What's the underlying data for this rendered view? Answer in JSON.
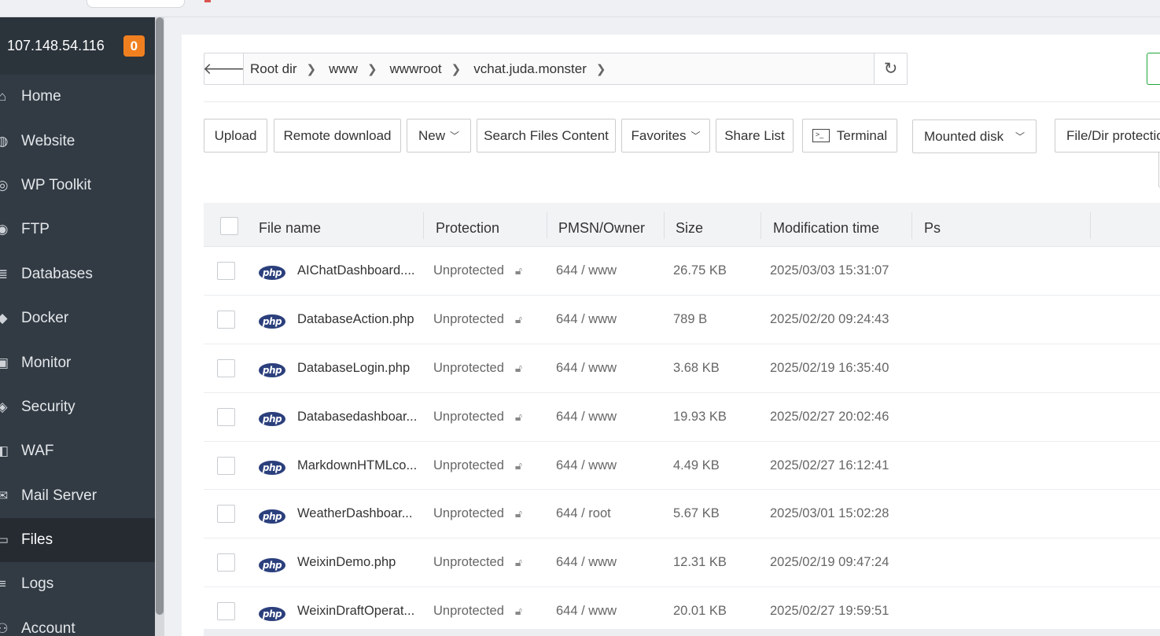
{
  "server": {
    "ip": "107.148.54.116",
    "badge": "0"
  },
  "sidebar": {
    "items": [
      {
        "label": "Home",
        "icon": "home-icon",
        "glyph": "⌂"
      },
      {
        "label": "Website",
        "icon": "globe-icon",
        "glyph": "◍"
      },
      {
        "label": "WP Toolkit",
        "icon": "wordpress-icon",
        "glyph": "◎"
      },
      {
        "label": "FTP",
        "icon": "ftp-icon",
        "glyph": "◉"
      },
      {
        "label": "Databases",
        "icon": "database-icon",
        "glyph": "≣"
      },
      {
        "label": "Docker",
        "icon": "docker-icon",
        "glyph": "◆"
      },
      {
        "label": "Monitor",
        "icon": "monitor-icon",
        "glyph": "▣"
      },
      {
        "label": "Security",
        "icon": "shield-icon",
        "glyph": "◈"
      },
      {
        "label": "WAF",
        "icon": "waf-icon",
        "glyph": "◧"
      },
      {
        "label": "Mail Server",
        "icon": "mail-icon",
        "glyph": "✉"
      },
      {
        "label": "Files",
        "icon": "folder-icon",
        "glyph": "▭",
        "active": true
      },
      {
        "label": "Logs",
        "icon": "logs-icon",
        "glyph": "≡"
      },
      {
        "label": "Account",
        "icon": "account-icon",
        "glyph": "⚇"
      }
    ]
  },
  "path": {
    "back_icon": "arrow-left-icon",
    "crumbs": [
      "Root dir",
      "www",
      "wwwroot",
      "vchat.juda.monster"
    ],
    "refresh_icon": "refresh-icon"
  },
  "toolbar": {
    "upload": "Upload",
    "remote_download": "Remote download",
    "new": "New",
    "search_content": "Search Files Content",
    "favorites": "Favorites",
    "share_list": "Share List",
    "terminal": "Terminal",
    "mounted_disk": "Mounted disk",
    "protection": "File/Dir protectio"
  },
  "table": {
    "headers": {
      "file_name": "File name",
      "protection": "Protection",
      "owner": "PMSN/Owner",
      "size": "Size",
      "mtime": "Modification time",
      "ps": "Ps"
    },
    "file_badge": "php",
    "rows": [
      {
        "name": "AIChatDashboard....",
        "protection": "Unprotected",
        "owner": "644 / www",
        "size": "26.75 KB",
        "mtime": "2025/03/03 15:31:07"
      },
      {
        "name": "DatabaseAction.php",
        "protection": "Unprotected",
        "owner": "644 / www",
        "size": "789 B",
        "mtime": "2025/02/20 09:24:43"
      },
      {
        "name": "DatabaseLogin.php",
        "protection": "Unprotected",
        "owner": "644 / www",
        "size": "3.68 KB",
        "mtime": "2025/02/19 16:35:40"
      },
      {
        "name": "Databasedashboar...",
        "protection": "Unprotected",
        "owner": "644 / www",
        "size": "19.93 KB",
        "mtime": "2025/02/27 20:02:46"
      },
      {
        "name": "MarkdownHTMLco...",
        "protection": "Unprotected",
        "owner": "644 / www",
        "size": "4.49 KB",
        "mtime": "2025/02/27 16:12:41"
      },
      {
        "name": "WeatherDashboar...",
        "protection": "Unprotected",
        "owner": "644 / root",
        "size": "5.67 KB",
        "mtime": "2025/03/01 15:02:28"
      },
      {
        "name": "WeixinDemo.php",
        "protection": "Unprotected",
        "owner": "644 / www",
        "size": "12.31 KB",
        "mtime": "2025/02/19 09:47:24"
      },
      {
        "name": "WeixinDraftOperat...",
        "protection": "Unprotected",
        "owner": "644 / www",
        "size": "20.01 KB",
        "mtime": "2025/02/27 19:59:51"
      }
    ]
  },
  "colors": {
    "sidebar_bg": "#323b44",
    "badge": "#f0801f",
    "php_badge": "#2b3f7c",
    "accent_green": "#20a53a"
  }
}
